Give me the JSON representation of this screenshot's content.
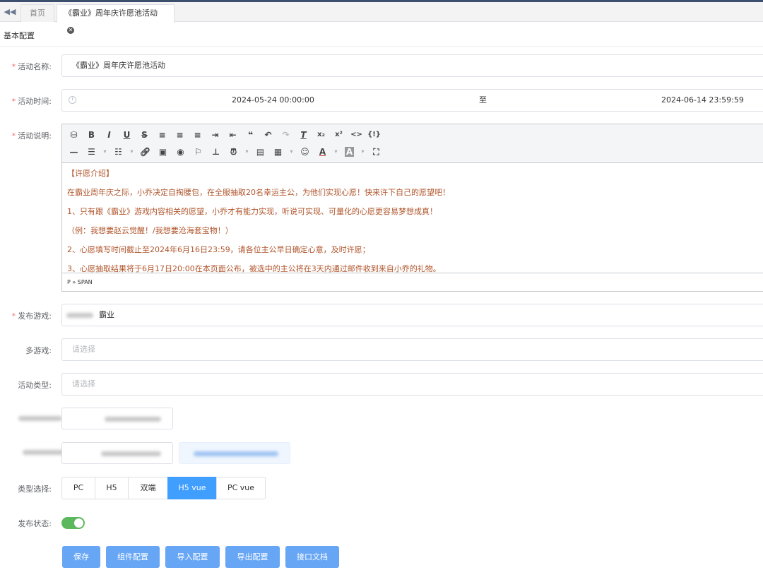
{
  "tabs": {
    "home": "首页",
    "active": "《霸业》周年庆许愿池活动"
  },
  "section_title": "基本配置",
  "form": {
    "name_label": "活动名称:",
    "name_value": "《霸业》周年庆许愿池活动",
    "time_label": "活动时间:",
    "time_start": "2024-05-24 00:00:00",
    "time_sep": "至",
    "time_end": "2024-06-14 23:59:59",
    "desc_label": "活动说明:",
    "game_label": "发布游戏:",
    "game_value": "霸业",
    "multi_label": "多游戏:",
    "multi_placeholder": "请选择",
    "type_label": "活动类型:",
    "type_placeholder": "请选择",
    "kind_label": "类型选择:",
    "status_label": "发布状态:"
  },
  "editor": {
    "lines": [
      "【许愿介绍】",
      "在霸业周年庆之际，小乔决定自掏腰包，在全服抽取20名幸运主公，为他们实现心愿！快来许下自己的愿望吧！",
      "1、只有跟《霸业》游戏内容相关的愿望，小乔才有能力实现，听说可实现、可量化的心愿更容易梦想成真！",
      "（例：我想要赵云觉醒！/我想要沧海套宝物！）",
      "2、心愿填写时间截止至2024年6月16日23:59，请各位主公早日确定心意，及时许愿；",
      "3、心愿抽取结果将于6月17日20:00在本页面公布，被选中的主公将在3天内通过邮件收到来自小乔的礼物。"
    ],
    "path": "P » SPAN",
    "text_color": "#b0552c"
  },
  "type_options": [
    "PC",
    "H5",
    "双端",
    "H5 vue",
    "PC vue"
  ],
  "type_selected": "H5 vue",
  "status_on": true,
  "buttons": {
    "save": "保存",
    "component": "组件配置",
    "import": "导入配置",
    "export": "导出配置",
    "api_doc": "接口文档"
  },
  "colors": {
    "primary": "#409eff",
    "button": "#66a6f5",
    "switch_on": "#5cb85c",
    "required": "#f56c6c"
  }
}
